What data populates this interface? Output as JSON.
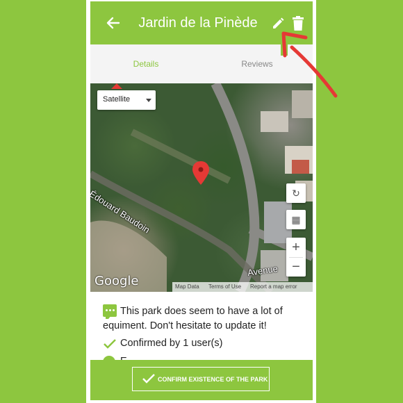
{
  "header": {
    "title": "Jardin de la Pinède"
  },
  "tabs": [
    {
      "label": "Details"
    },
    {
      "label": "Reviews"
    }
  ],
  "map": {
    "type_selector": "Satellite",
    "street_label_1": "Édouard Baudoin",
    "street_label_2": "Avenue",
    "google": "Google",
    "footer": {
      "map_data": "Map Data",
      "terms": "Terms of Use",
      "report": "Report a map error"
    }
  },
  "content": {
    "message": "This park does seem to have a lot of equiment. Don't hesitate to update it!",
    "confirmed": "Confirmed by 1 user(s)",
    "partial_line": "E"
  },
  "footer": {
    "confirm_button": "CONFIRM EXISTENCE OF THE PARK"
  },
  "colors": {
    "brand": "#8dc63f",
    "annotation": "#e53935"
  }
}
